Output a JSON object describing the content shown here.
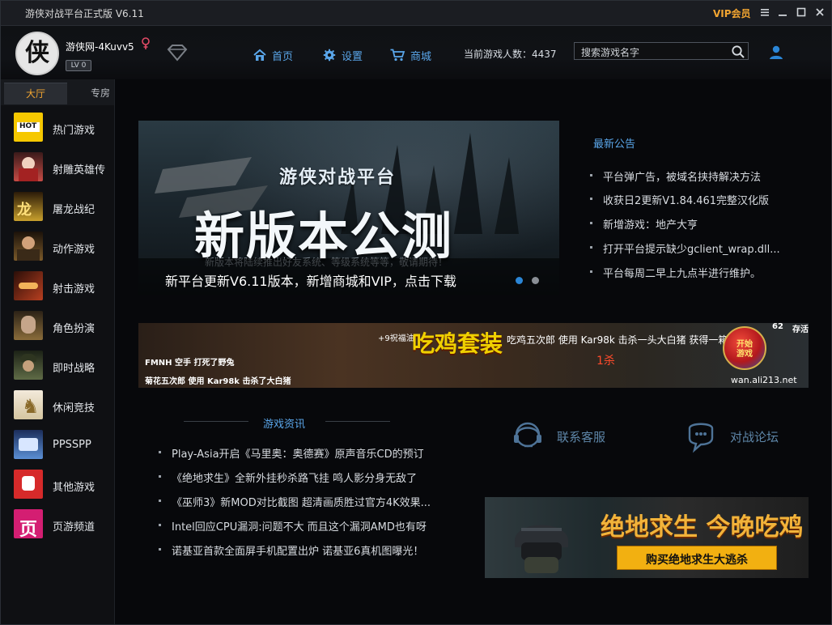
{
  "titlebar": {
    "title": "游侠对战平台正式版 V6.11",
    "vip_label": "VIP会员"
  },
  "header": {
    "avatar_glyph": "侠",
    "username": "游侠网-4Kuvv5",
    "level_badge": "LV 0",
    "nav": [
      {
        "label": "首页",
        "icon": "home-icon"
      },
      {
        "label": "设置",
        "icon": "gear-icon"
      },
      {
        "label": "商城",
        "icon": "cart-icon"
      }
    ],
    "online_text": "当前游戏人数：4437",
    "search_placeholder": "搜索游戏名字"
  },
  "sidebar": {
    "tabs": [
      {
        "label": "大厅",
        "active": true
      },
      {
        "label": "专房",
        "active": false
      }
    ],
    "items": [
      {
        "label": "热门游戏",
        "icon": "hot-games-icon",
        "color": "#f6c800"
      },
      {
        "label": "射雕英雄传",
        "icon": "heroine-portrait-icon",
        "color": "#c64b45"
      },
      {
        "label": "屠龙战纪",
        "icon": "dragon-title-icon",
        "color": "#c8a02d"
      },
      {
        "label": "动作游戏",
        "icon": "action-warrior-icon",
        "color": "#7b5a2a"
      },
      {
        "label": "射击游戏",
        "icon": "bullet-icon",
        "color": "#b83f20"
      },
      {
        "label": "角色扮演",
        "icon": "roleplay-face-icon",
        "color": "#8a6c3a"
      },
      {
        "label": "即时战略",
        "icon": "soldier-icon",
        "color": "#5f6b46"
      },
      {
        "label": "休闲竞技",
        "icon": "chess-knight-icon",
        "color": "#d5c6a0"
      },
      {
        "label": "PPSSPP",
        "icon": "ppsspp-icon",
        "color": "#5b8fd4"
      },
      {
        "label": "其他游戏",
        "icon": "fist-icon",
        "color": "#d62a2a"
      },
      {
        "label": "页游频道",
        "icon": "web-game-icon",
        "color": "#d41e72"
      }
    ]
  },
  "banner": {
    "subtitle": "游侠对战平台",
    "headline": "新版本公测",
    "note": "新版本将陆续推出好友系统、等级系统等等，敬请期待！",
    "caption": "新平台更新V6.11版本，新增商城和VIP，点击下载"
  },
  "announcements": {
    "title": "最新公告",
    "items": [
      "平台弹广告，被域名挟持解决方法",
      "收获日2更新V1.84.461完整汉化版",
      "新增游戏：地产大亨",
      "打开平台提示缺少gclient_wrap.dll...",
      "平台每周二早上九点半进行维护。"
    ]
  },
  "strip_ad": {
    "title": "吃鸡套装",
    "line1": "吃鸡五次郎 使用 Kar98k 击杀一头大白猪 获得一箱装备",
    "line2": "FMNH 空手 打死了野兔",
    "line3": "菊花五次郎 使用 Kar98k 击杀了大白猪",
    "site": "wan.ali213.net",
    "kills": "1杀",
    "buff": "+9祝福油",
    "level": "62",
    "tag": "存活",
    "start_button": "开始\n游戏"
  },
  "news": {
    "title": "游戏资讯",
    "items": [
      "Play-Asia开启《马里奥：奥德赛》原声音乐CD的预订",
      "《绝地求生》全新外挂秒杀路飞挂 鸣人影分身无敌了",
      "《巫师3》新MOD对比截图 超清画质胜过官方4K效果...",
      "Intel回应CPU漏洞:问题不大 而且这个漏洞AMD也有呀",
      "诺基亚首款全面屏手机配置出炉 诺基亚6真机图曝光！"
    ]
  },
  "services": {
    "customer_service": "联系客服",
    "forum": "对战论坛"
  },
  "pubg_ad": {
    "title": "绝地求生 今晚吃鸡",
    "cta": "购买绝地求生大逃杀"
  },
  "colors": {
    "accent_blue": "#5aa6ea",
    "vip_gold": "#f2a531",
    "background": "#07080b"
  }
}
